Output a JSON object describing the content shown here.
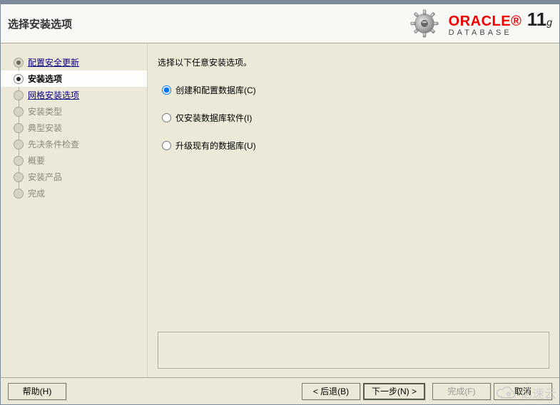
{
  "header": {
    "title": "选择安装选项",
    "brand_line1": "ORACLE",
    "brand_version": "11",
    "brand_suffix": "g",
    "brand_line2": "DATABASE"
  },
  "sidebar": {
    "steps": [
      {
        "label": "配置安全更新",
        "state": "done",
        "link": true
      },
      {
        "label": "安装选项",
        "state": "current",
        "link": false
      },
      {
        "label": "网格安装选项",
        "state": "pending",
        "link": true
      },
      {
        "label": "安装类型",
        "state": "pending",
        "link": false
      },
      {
        "label": "典型安装",
        "state": "pending",
        "link": false
      },
      {
        "label": "先决条件检查",
        "state": "pending",
        "link": false
      },
      {
        "label": "概要",
        "state": "pending",
        "link": false
      },
      {
        "label": "安装产品",
        "state": "pending",
        "link": false
      },
      {
        "label": "完成",
        "state": "pending",
        "link": false
      }
    ]
  },
  "content": {
    "instruction": "选择以下任意安装选项。",
    "options": [
      {
        "label": "创建和配置数据库(C)",
        "selected": true
      },
      {
        "label": "仅安装数据库软件(I)",
        "selected": false
      },
      {
        "label": "升级现有的数据库(U)",
        "selected": false
      }
    ]
  },
  "footer": {
    "help": "帮助(H)",
    "back": "< 后退(B)",
    "next": "下一步(N) >",
    "finish": "完成(F)",
    "cancel": "取消"
  },
  "watermark": "亿速云"
}
